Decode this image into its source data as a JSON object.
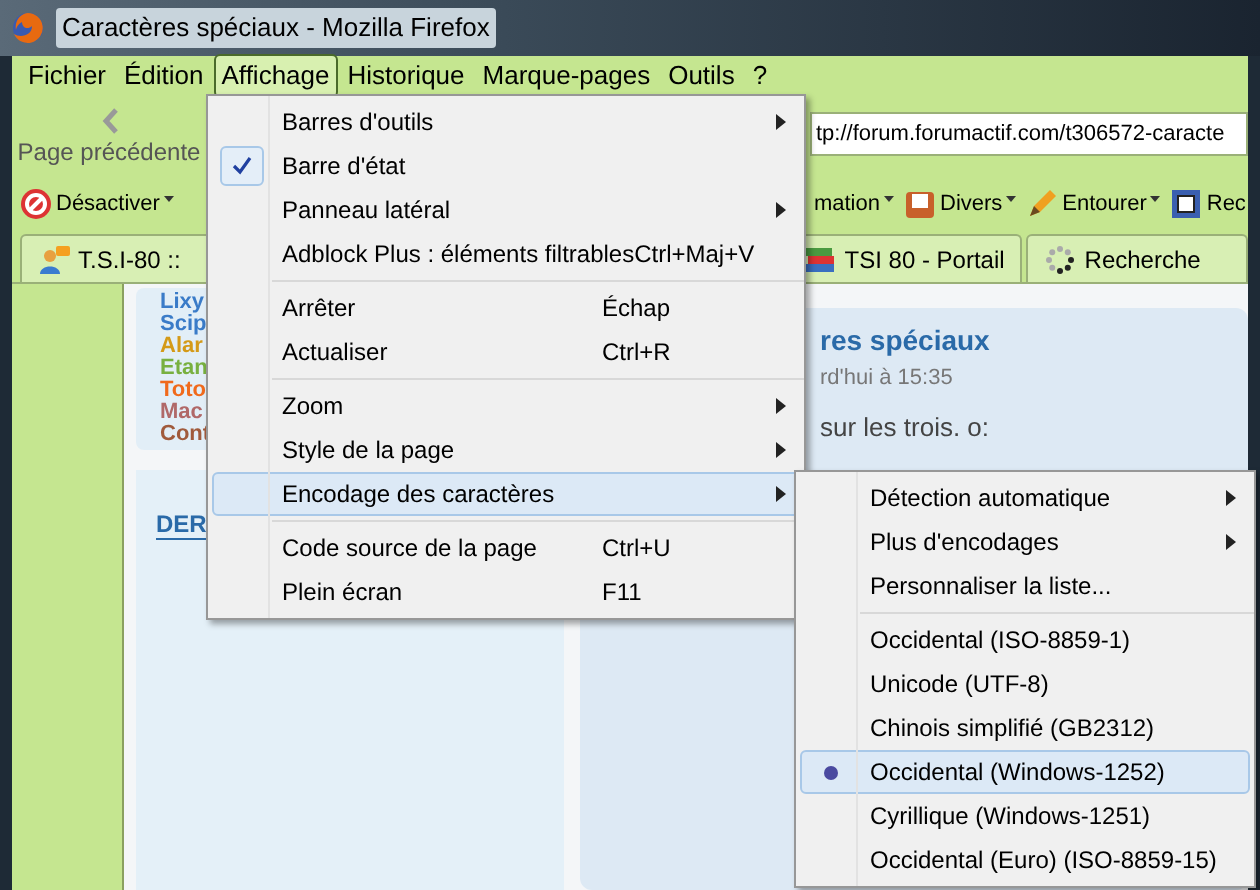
{
  "window": {
    "title": "Caractères spéciaux - Mozilla Firefox"
  },
  "menubar": [
    {
      "label": "Fichier",
      "selected": false
    },
    {
      "label": "Édition",
      "selected": false
    },
    {
      "label": "Affichage",
      "selected": true
    },
    {
      "label": "Historique",
      "selected": false
    },
    {
      "label": "Marque-pages",
      "selected": false
    },
    {
      "label": "Outils",
      "selected": false
    },
    {
      "label": "?",
      "selected": false
    }
  ],
  "navigation": {
    "back_label": "Page précédente",
    "url": "tp://forum.forumactif.com/t306572-caracte"
  },
  "toolbar": [
    {
      "kind": "block",
      "label": "Désactiver"
    },
    {
      "kind": "plain",
      "label": "mation"
    },
    {
      "kind": "box",
      "label": "Divers"
    },
    {
      "kind": "pencil",
      "label": "Entourer"
    },
    {
      "kind": "crop",
      "label": "Rec"
    }
  ],
  "tabs": [
    {
      "kind": "user",
      "label": "T.S.I-80 ::"
    },
    {
      "kind": "books",
      "label": "TSI 80 - Portail"
    },
    {
      "kind": "loading",
      "label": "Recherche"
    }
  ],
  "page": {
    "names": [
      {
        "text": "Lixy",
        "color": "#3a7bc8"
      },
      {
        "text": "Scip",
        "color": "#3a7bc8"
      },
      {
        "text": "Alar",
        "color": "#d49a18"
      },
      {
        "text": "Etan",
        "color": "#78b040"
      },
      {
        "text": "Toto",
        "color": "#f06a1c"
      },
      {
        "text": "Mac",
        "color": "#b06868"
      },
      {
        "text": "Cont",
        "color": "#a05a3c"
      }
    ],
    "heading": "DER",
    "post_title": "res spéciaux",
    "post_date": "rd'hui à 15:35",
    "post_text": "sur les trois. o:"
  },
  "menu": [
    {
      "kind": "item",
      "label": "Barres d'outils",
      "submenu": true,
      "checked": false,
      "selected": false
    },
    {
      "kind": "item",
      "label": "Barre d'état",
      "submenu": false,
      "checked": true,
      "selected": false
    },
    {
      "kind": "item",
      "label": "Panneau latéral",
      "submenu": true,
      "checked": false,
      "selected": false
    },
    {
      "kind": "item",
      "label": "Adblock Plus : éléments filtrables",
      "shortcut": "Ctrl+Maj+V",
      "submenu": false,
      "checked": false,
      "selected": false
    },
    {
      "kind": "separator"
    },
    {
      "kind": "item",
      "label": "Arrêter",
      "shortcut": "Échap",
      "submenu": false,
      "checked": false,
      "selected": false
    },
    {
      "kind": "item",
      "label": "Actualiser",
      "shortcut": "Ctrl+R",
      "submenu": false,
      "checked": false,
      "selected": false
    },
    {
      "kind": "separator"
    },
    {
      "kind": "item",
      "label": "Zoom",
      "submenu": true,
      "checked": false,
      "selected": false
    },
    {
      "kind": "item",
      "label": "Style de la page",
      "submenu": true,
      "checked": false,
      "selected": false
    },
    {
      "kind": "item",
      "label": "Encodage des caractères",
      "submenu": true,
      "checked": false,
      "selected": true
    },
    {
      "kind": "separator"
    },
    {
      "kind": "item",
      "label": "Code source de la page",
      "shortcut": "Ctrl+U",
      "submenu": false,
      "checked": false,
      "selected": false
    },
    {
      "kind": "item",
      "label": "Plein écran",
      "shortcut": "F11",
      "submenu": false,
      "checked": false,
      "selected": false
    }
  ],
  "submenu": [
    {
      "kind": "item",
      "label": "Détection automatique",
      "submenu": true,
      "checked": false,
      "selected": false
    },
    {
      "kind": "item",
      "label": "Plus d'encodages",
      "submenu": true,
      "checked": false,
      "selected": false
    },
    {
      "kind": "item",
      "label": "Personnaliser la liste...",
      "submenu": false,
      "checked": false,
      "selected": false
    },
    {
      "kind": "separator"
    },
    {
      "kind": "item",
      "label": "Occidental (ISO-8859-1)",
      "submenu": false,
      "checked": false,
      "selected": false
    },
    {
      "kind": "item",
      "label": "Unicode (UTF-8)",
      "submenu": false,
      "checked": false,
      "selected": false
    },
    {
      "kind": "item",
      "label": "Chinois simplifié (GB2312)",
      "submenu": false,
      "checked": false,
      "selected": false
    },
    {
      "kind": "item",
      "label": "Occidental (Windows-1252)",
      "submenu": false,
      "checked": true,
      "selected": true
    },
    {
      "kind": "item",
      "label": "Cyrillique (Windows-1251)",
      "submenu": false,
      "checked": false,
      "selected": false
    },
    {
      "kind": "item",
      "label": "Occidental (Euro) (ISO-8859-15)",
      "submenu": false,
      "checked": false,
      "selected": false
    }
  ]
}
